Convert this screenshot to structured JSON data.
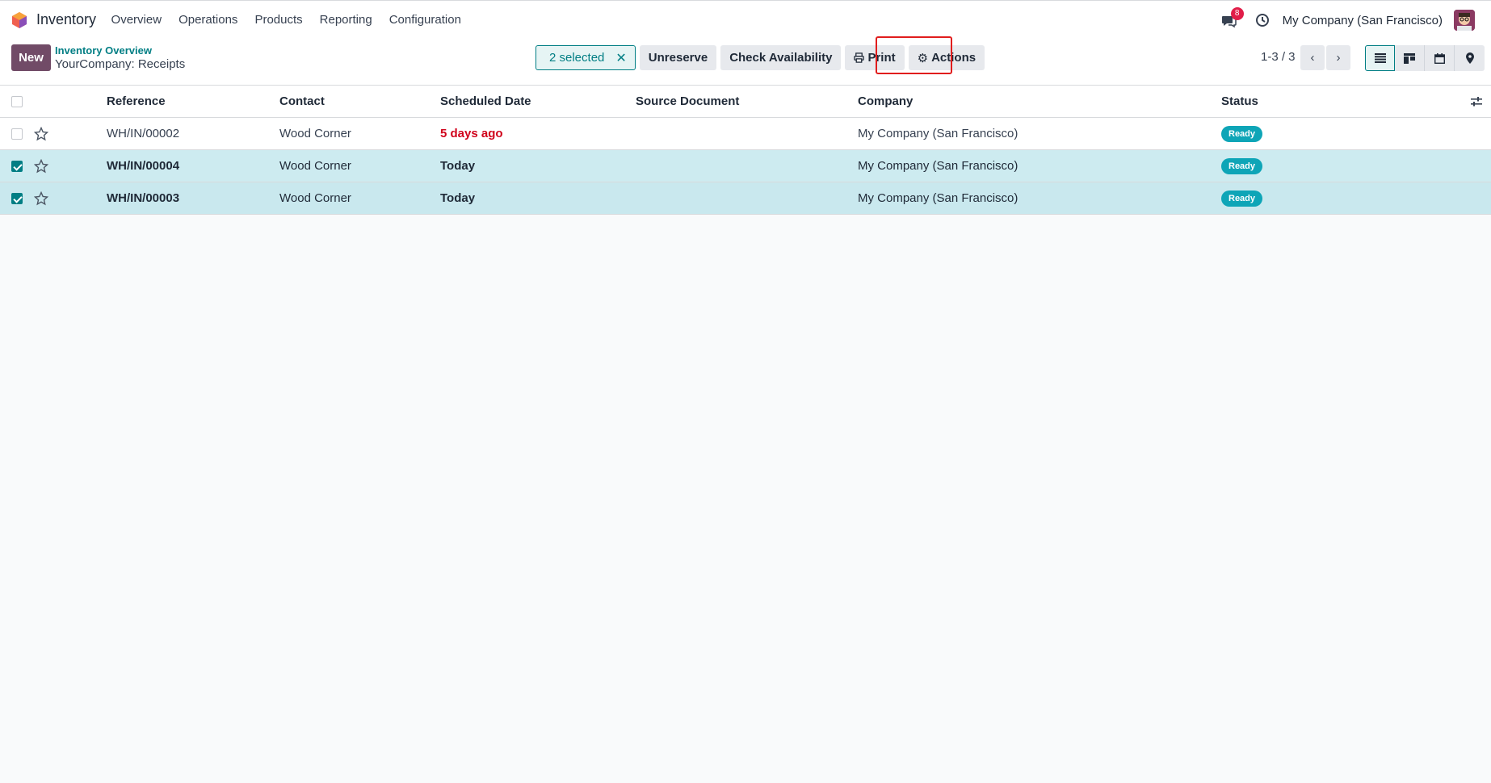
{
  "navbar": {
    "app_name": "Inventory",
    "menu": [
      "Overview",
      "Operations",
      "Products",
      "Reporting",
      "Configuration"
    ],
    "messages_badge": "8",
    "company": "My Company (San Francisco)"
  },
  "control": {
    "new_label": "New",
    "breadcrumb_parent": "Inventory Overview",
    "breadcrumb_current": "YourCompany: Receipts",
    "selected_label": "2 selected",
    "buttons": {
      "unreserve": "Unreserve",
      "check_availability": "Check Availability",
      "print": "Print",
      "actions": "Actions"
    },
    "pager": "1-3 / 3"
  },
  "table": {
    "headers": {
      "reference": "Reference",
      "contact": "Contact",
      "scheduled_date": "Scheduled Date",
      "source_document": "Source Document",
      "company": "Company",
      "status": "Status"
    },
    "rows": [
      {
        "selected": false,
        "reference": "WH/IN/00002",
        "contact": "Wood Corner",
        "scheduled_date": "5 days ago",
        "source_document": "",
        "company": "My Company (San Francisco)",
        "status": "Ready"
      },
      {
        "selected": true,
        "reference": "WH/IN/00004",
        "contact": "Wood Corner",
        "scheduled_date": "Today",
        "source_document": "",
        "company": "My Company (San Francisco)",
        "status": "Ready"
      },
      {
        "selected": true,
        "reference": "WH/IN/00003",
        "contact": "Wood Corner",
        "scheduled_date": "Today",
        "source_document": "",
        "company": "My Company (San Francisco)",
        "status": "Ready"
      }
    ]
  },
  "icons": {
    "app": "odoo-inventory-logo",
    "chat": "chat-icon",
    "clock": "clock-icon",
    "print": "print-icon",
    "actions": "gear-icon",
    "views": [
      "list-view-icon",
      "kanban-view-icon",
      "calendar-view-icon",
      "map-view-icon"
    ]
  },
  "colors": {
    "brand": "#714b67",
    "accent": "#017e84",
    "late": "#d0021b",
    "today": "#a8791b",
    "status_ready": "#0ea5b7",
    "selected_row": "#c9e8ee",
    "highlight": "#e11d1d"
  }
}
